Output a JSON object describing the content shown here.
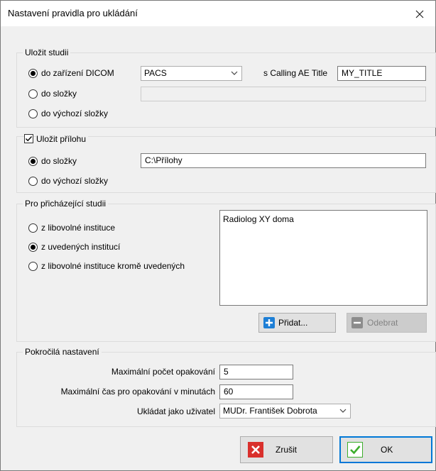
{
  "dialog": {
    "title": "Nastavení pravidla pro ukládání"
  },
  "save_study": {
    "legend": "Uložit studii",
    "option_dicom": "do zařízení DICOM",
    "option_folder": "do složky",
    "option_default_folder": "do výchozí složky",
    "selected": "dicom",
    "dicom_device": "PACS",
    "calling_ae_label": "s Calling AE Title",
    "calling_ae_value": "MY_TITLE",
    "folder_value": ""
  },
  "save_attachment": {
    "legend": "Uložit přílohu",
    "checked": true,
    "option_folder": "do složky",
    "option_default_folder": "do výchozí složky",
    "selected": "folder",
    "folder_value": "C:\\Přílohy"
  },
  "incoming_study": {
    "legend": "Pro přicházející studii",
    "option_any": "z libovolné instituce",
    "option_listed": "z uvedených institucí",
    "option_any_except": "z libovolné instituce kromě uvedených",
    "selected": "listed",
    "institutions": [
      "Radiolog XY doma"
    ],
    "add_label": "Přidat...",
    "remove_label": "Odebrat"
  },
  "advanced": {
    "legend": "Pokročilá nastavení",
    "max_retries_label": "Maximální počet opakování",
    "max_retries_value": "5",
    "max_retry_time_label": "Maximální čas pro opakování v minutách",
    "max_retry_time_value": "60",
    "save_as_user_label": "Ukládat jako uživatel",
    "save_as_user_value": "MUDr. František Dobrota"
  },
  "footer": {
    "cancel_label": "Zrušit",
    "ok_label": "OK"
  },
  "colors": {
    "accent": "#0078d7",
    "cancel_icon": "#d9302c",
    "ok_icon": "#3cae2c",
    "add_icon": "#1e7fd6"
  }
}
